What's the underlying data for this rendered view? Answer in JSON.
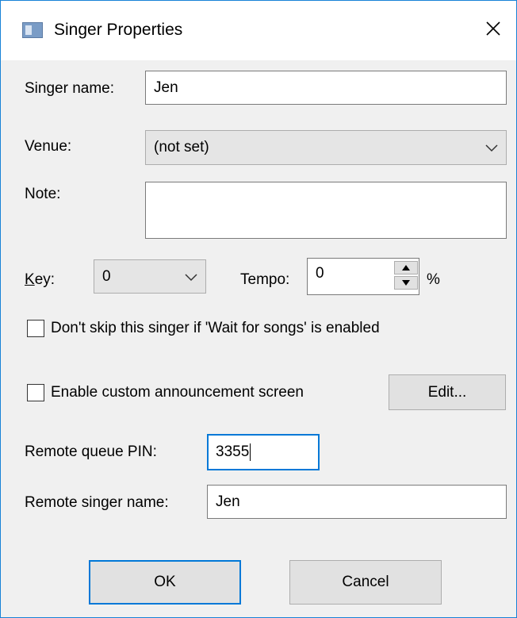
{
  "window": {
    "title": "Singer Properties"
  },
  "fields": {
    "singer_name_label": "Singer name:",
    "singer_name_value": "Jen",
    "venue_label": "Venue:",
    "venue_value": "(not set)",
    "note_label": "Note:",
    "note_value": "",
    "key_label": "Key:",
    "key_value": "0",
    "tempo_label": "Tempo:",
    "tempo_value": "0",
    "tempo_unit": "%"
  },
  "options": {
    "dont_skip_label": "Don't skip this singer if 'Wait for songs' is enabled",
    "dont_skip_checked": false,
    "custom_announcement_label": "Enable custom announcement screen",
    "custom_announcement_checked": false,
    "edit_label": "Edit..."
  },
  "remote": {
    "pin_label": "Remote queue PIN:",
    "pin_value": "3355",
    "singer_name_label": "Remote singer name:",
    "singer_name_value": "Jen"
  },
  "buttons": {
    "ok_label": "OK",
    "cancel_label": "Cancel"
  },
  "icons": {
    "app": "app-window-icon",
    "close": "close-icon",
    "dropdown": "chevron-down-icon",
    "spin_up": "spin-up-icon",
    "spin_down": "spin-down-icon"
  },
  "colors": {
    "focus_accent": "#0078d7",
    "dialog_background": "#f0f0f0",
    "window_border": "#1883d7"
  }
}
